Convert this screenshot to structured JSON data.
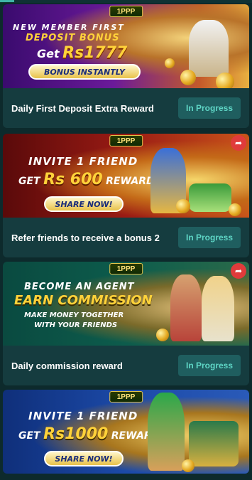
{
  "brand": "1PPP",
  "status_label": "In Progress",
  "cards": [
    {
      "line1": "NEW MEMBER FIRST",
      "line2": "DEPOSIT BONUS",
      "line3_prefix": "Get",
      "line3_amount": "Rs1777",
      "pill": "BONUS INSTANTLY",
      "reward_label": "Daily First Deposit Extra Reward"
    },
    {
      "line1": "INVITE 1 FRIEND",
      "line2_prefix": "GET",
      "line2_amount": "Rs 600",
      "line2_suffix": "REWARD",
      "pill": "SHARE NOW!",
      "reward_label": "Refer friends to receive a bonus 2"
    },
    {
      "line1": "BECOME AN AGENT",
      "line2": "EARN COMMISSION",
      "line3": "MAKE MONEY TOGETHER",
      "line4": "WITH YOUR FRIENDS",
      "reward_label": "Daily commission reward"
    },
    {
      "line1": "INVITE 1 FRIEND",
      "line2_prefix": "GET",
      "line2_amount": "Rs1000",
      "line2_suffix": "REWARD",
      "pill": "SHARE NOW!"
    }
  ],
  "colors": {
    "background": "#0d2a2c",
    "info_bar": "#153c3f",
    "status_button": "#1f5e5f",
    "status_text": "#5fd6c6"
  },
  "icons": [
    "share-icon"
  ]
}
